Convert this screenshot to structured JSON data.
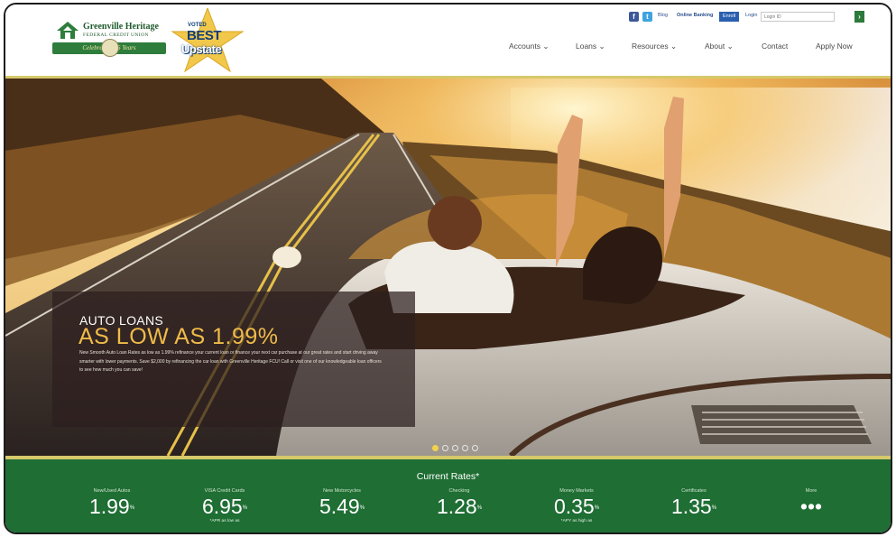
{
  "header": {
    "logo": {
      "name": "Greenville Heritage",
      "subtitle": "FEDERAL CREDIT UNION",
      "ribbon": "Celebrating 75 Years"
    },
    "badge": {
      "voted": "VOTED",
      "best": "BEST",
      "place": "Upstate"
    },
    "utility": {
      "facebook_icon": "f",
      "twitter_icon": "t",
      "blog": "Blog",
      "online_banking": "Online Banking",
      "enroll": "Enroll",
      "login": "Login",
      "login_placeholder": "Login ID",
      "go": "›"
    },
    "nav": [
      {
        "label": "Accounts ⌄"
      },
      {
        "label": "Loans ⌄"
      },
      {
        "label": "Resources ⌄"
      },
      {
        "label": "About ⌄"
      },
      {
        "label": "Contact"
      },
      {
        "label": "Apply Now"
      }
    ]
  },
  "hero": {
    "promo": {
      "title": "AUTO LOANS",
      "headline": "AS LOW AS 1.99%",
      "body": "New Smooth Auto Loan Rates as low as 1.99% refinance your current loan or finance your next car purchase at our great rates and start driving away smarter with lower payments. Save $2,000 by refinancing the car loan with Greenville Heritage FCU! Call or visit one of our knowledgeable loan officers to see how much you can save!"
    },
    "slides": 5,
    "active_slide": 1
  },
  "rates": {
    "title": "Current Rates*",
    "items": [
      {
        "label": "New/Used Autos",
        "value": "1.99",
        "sup": "%",
        "note": ""
      },
      {
        "label": "VISA Credit Cards",
        "value": "6.95",
        "sup": "%",
        "note": "*APR as low as"
      },
      {
        "label": "New Motorcycles",
        "value": "5.49",
        "sup": "%",
        "note": ""
      },
      {
        "label": "Checking",
        "value": "1.28",
        "sup": "%",
        "note": ""
      },
      {
        "label": "Money Markets",
        "value": "0.35",
        "sup": "%",
        "note": "*APY as high as"
      },
      {
        "label": "Certificates",
        "value": "1.35",
        "sup": "%",
        "note": ""
      },
      {
        "label": "More",
        "value": "•••",
        "sup": "",
        "note": ""
      }
    ]
  }
}
